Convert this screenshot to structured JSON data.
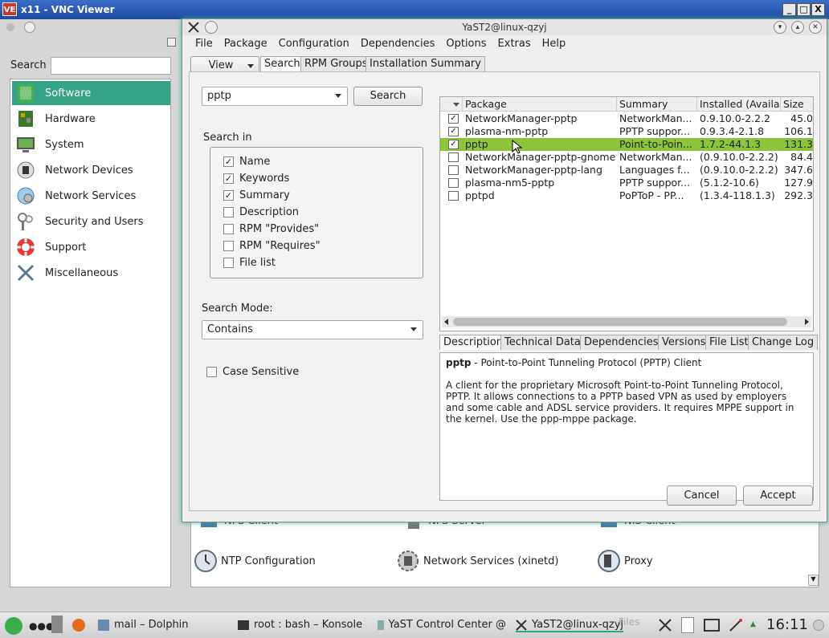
{
  "vnc": {
    "logo": "VE",
    "title": "x11 - VNC Viewer",
    "min": "_",
    "max": "□",
    "close": "X"
  },
  "control_center": {
    "search_label": "Search",
    "categories": [
      {
        "label": "Software"
      },
      {
        "label": "Hardware"
      },
      {
        "label": "System"
      },
      {
        "label": "Network Devices"
      },
      {
        "label": "Network Services"
      },
      {
        "label": "Security and Users"
      },
      {
        "label": "Support"
      },
      {
        "label": "Miscellaneous"
      }
    ],
    "modules": [
      {
        "label": "NFS Client"
      },
      {
        "label": "NFS Server"
      },
      {
        "label": "NIS Client"
      },
      {
        "label": "NTP Configuration"
      },
      {
        "label": "Network Services (xinetd)"
      },
      {
        "label": "Proxy"
      }
    ]
  },
  "dialog": {
    "title": "YaST2@linux-qzyj",
    "menu": [
      "File",
      "Package",
      "Configuration",
      "Dependencies",
      "Options",
      "Extras",
      "Help"
    ],
    "view_button": "View",
    "tabs": [
      "Search",
      "RPM Groups",
      "Installation Summary"
    ],
    "search_value": "pptp",
    "search_button": "Search",
    "search_in_label": "Search in",
    "search_in": [
      {
        "label": "Name",
        "checked": "✓"
      },
      {
        "label": "Keywords",
        "checked": "✓"
      },
      {
        "label": "Summary",
        "checked": "✓"
      },
      {
        "label": "Description",
        "checked": ""
      },
      {
        "label": "RPM \"Provides\"",
        "checked": ""
      },
      {
        "label": "RPM \"Requires\"",
        "checked": ""
      },
      {
        "label": "File list",
        "checked": ""
      }
    ],
    "search_mode_label": "Search Mode:",
    "search_mode_value": "Contains",
    "case_sensitive_label": "Case Sensitive",
    "table_headers": [
      "Package",
      "Summary",
      "Installed (Availal",
      "Size"
    ],
    "packages": [
      {
        "check": "✓",
        "name": "NetworkManager-pptp",
        "summary": "NetworkMan...",
        "installed": "0.9.10.0-2.2.2",
        "size": "45.0"
      },
      {
        "check": "✓",
        "name": "plasma-nm-pptp",
        "summary": "PPTP suppor...",
        "installed": "0.9.3.4-2.1.8",
        "size": "106.1"
      },
      {
        "check": "✓",
        "name": "pptp",
        "summary": "Point-to-Poin...",
        "installed": "1.7.2-44.1.3",
        "size": "131.3"
      },
      {
        "check": "",
        "name": "NetworkManager-pptp-gnome",
        "summary": "NetworkMan...",
        "installed": "(0.9.10.0-2.2.2)",
        "size": "84.4"
      },
      {
        "check": "",
        "name": "NetworkManager-pptp-lang",
        "summary": "Languages f...",
        "installed": "(0.9.10.0-2.2.2)",
        "size": "347.6"
      },
      {
        "check": "",
        "name": "plasma-nm5-pptp",
        "summary": "PPTP suppor...",
        "installed": "(5.1.2-10.6)",
        "size": "127.9"
      },
      {
        "check": "",
        "name": "pptpd",
        "summary": "PoPToP - PP...",
        "installed": "(1.3.4-118.1.3)",
        "size": "292.3"
      }
    ],
    "detail_tabs": [
      "Description",
      "Technical Data",
      "Dependencies",
      "Versions",
      "File List",
      "Change Log"
    ],
    "desc_pkg": "pptp",
    "desc_summary": " - Point-to-Point Tunneling Protocol (PPTP) Client",
    "desc_body": "A client for the proprietary Microsoft Point-to-Point Tunneling Protocol, PPTP. It allows connections to a PPTP based VPN as used by employers and some cable and ADSL service providers. It requires MPPE support in the kernel. Use the ppp-mppe package.",
    "cancel": "Cancel",
    "accept": "Accept"
  },
  "taskbar": {
    "tasks": [
      "mail – Dolphin",
      "root : bash – Konsole",
      "YaST Control Center @",
      "YaST2@linux-qzyj"
    ],
    "ghost": "Files",
    "clock": "16:11"
  },
  "colors": {
    "accent": "#35a386",
    "selection": "#8cc43b",
    "titlebar": "#2a5bb8"
  }
}
